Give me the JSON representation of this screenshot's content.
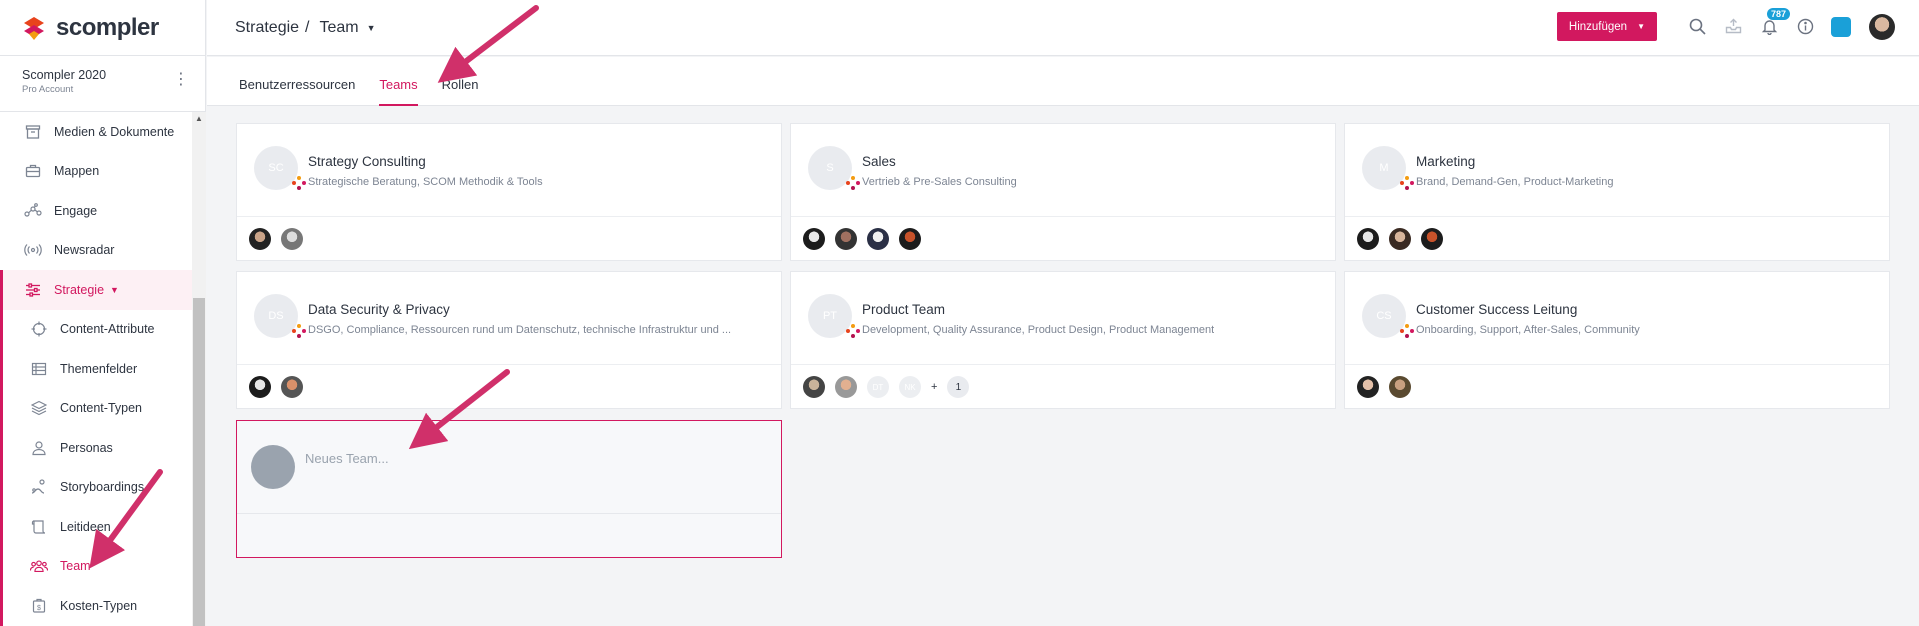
{
  "brand": {
    "name": "scompler",
    "accent": "#d2185f"
  },
  "account": {
    "name": "Scompler 2020",
    "plan": "Pro Account"
  },
  "nav": {
    "items": [
      {
        "label": "Medien & Dokumente",
        "icon": "archive-icon"
      },
      {
        "label": "Mappen",
        "icon": "briefcase-icon"
      },
      {
        "label": "Engage",
        "icon": "network-icon"
      },
      {
        "label": "Newsradar",
        "icon": "broadcast-icon"
      },
      {
        "label": "Strategie",
        "icon": "sliders-icon"
      },
      {
        "label": "Content-Attribute",
        "icon": "crosshair-icon"
      },
      {
        "label": "Themenfelder",
        "icon": "table-icon"
      },
      {
        "label": "Content-Typen",
        "icon": "layers-icon"
      },
      {
        "label": "Personas",
        "icon": "user-icon"
      },
      {
        "label": "Storyboardings",
        "icon": "storyboard-icon"
      },
      {
        "label": "Leitideen",
        "icon": "scroll-icon"
      },
      {
        "label": "Team",
        "icon": "team-icon"
      },
      {
        "label": "Kosten-Typen",
        "icon": "cost-icon"
      }
    ]
  },
  "header": {
    "breadcrumb_parent": "Strategie",
    "breadcrumb_sep": "/",
    "breadcrumb_current": "Team",
    "add_button": "Hinzufügen",
    "notification_count": "787"
  },
  "tabs": [
    "Benutzerressourcen",
    "Teams",
    "Rollen"
  ],
  "teams": [
    {
      "initials": "SC",
      "name": "Strategy Consulting",
      "desc": "Strategische Beratung, SCOM Methodik & Tools"
    },
    {
      "initials": "S",
      "name": "Sales",
      "desc": "Vertrieb & Pre-Sales Consulting"
    },
    {
      "initials": "M",
      "name": "Marketing",
      "desc": "Brand, Demand-Gen, Product-Marketing"
    },
    {
      "initials": "DS",
      "name": "Data Security & Privacy",
      "desc": "DSGO, Compliance, Ressourcen rund um Datenschutz, technische Infrastruktur und ..."
    },
    {
      "initials": "PT",
      "name": "Product Team",
      "desc": "Development, Quality Assurance, Product Design, Product Management"
    },
    {
      "initials": "CS",
      "name": "Customer Success Leitung",
      "desc": "Onboarding, Support, After-Sales, Community"
    }
  ],
  "product_team_extra": {
    "ghost_1": "DT",
    "ghost_2": "NK",
    "plus": "+",
    "count": "1"
  },
  "new_team": {
    "placeholder": "Neues Team..."
  }
}
